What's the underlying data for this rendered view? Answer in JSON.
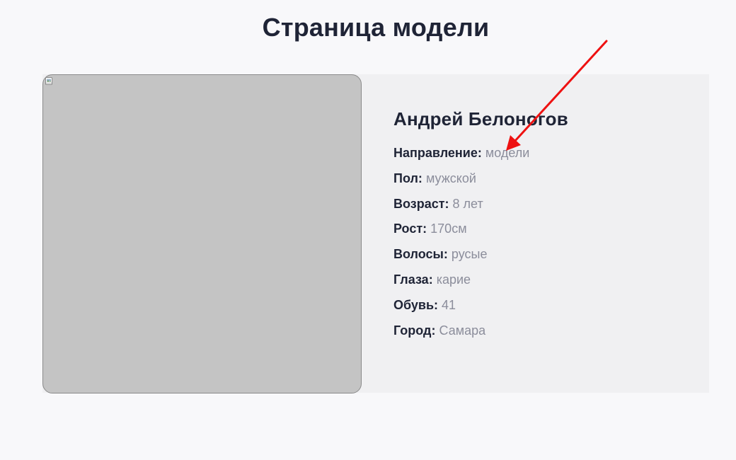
{
  "page": {
    "title": "Страница модели"
  },
  "model": {
    "name": "Андрей Белоногов",
    "attributes": [
      {
        "label": "Направление:",
        "value": "модели"
      },
      {
        "label": "Пол:",
        "value": "мужской"
      },
      {
        "label": "Возраст:",
        "value": "8 лет"
      },
      {
        "label": "Рост:",
        "value": "170см"
      },
      {
        "label": "Волосы:",
        "value": "русые"
      },
      {
        "label": "Глаза:",
        "value": "карие"
      },
      {
        "label": "Обувь:",
        "value": "41"
      },
      {
        "label": "Город:",
        "value": "Самара"
      }
    ]
  },
  "photo": {
    "icon": "broken-image-icon",
    "placeholder_color": "#c4c4c4"
  },
  "annotation": {
    "icon": "red-arrow",
    "color": "#ee1111",
    "target": "Направление value"
  },
  "colors": {
    "heading": "#1f2436",
    "value": "#8b8d9b",
    "card_bg": "#f0f0f2",
    "page_bg": "#f8f8fa"
  }
}
